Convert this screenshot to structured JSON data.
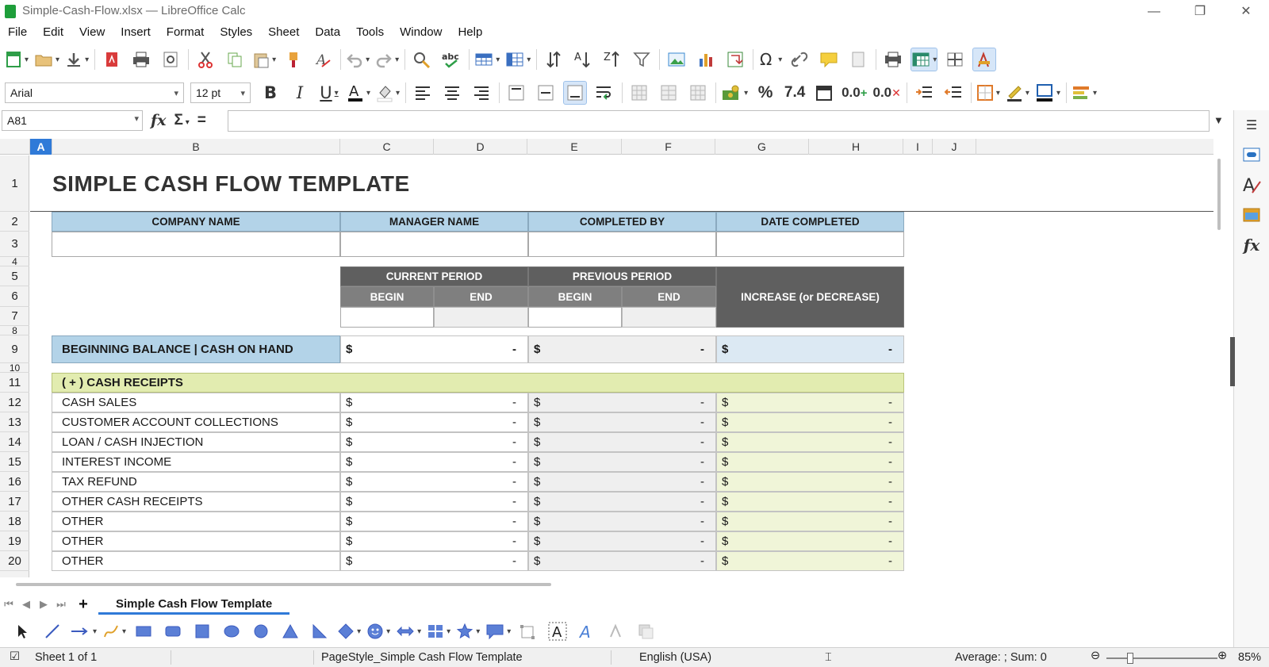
{
  "window": {
    "title": "Simple-Cash-Flow.xlsx — LibreOffice Calc",
    "controls": {
      "minimize": "—",
      "restore": "❐",
      "close": "✕"
    }
  },
  "menu": [
    "File",
    "Edit",
    "View",
    "Insert",
    "Format",
    "Styles",
    "Sheet",
    "Data",
    "Tools",
    "Window",
    "Help"
  ],
  "format_toolbar": {
    "font_name": "Arial",
    "font_size": "12 pt",
    "percent": "%",
    "number_format": "7.4",
    "add_decimal": "0.0",
    "remove_decimal": "0.0"
  },
  "formula_bar": {
    "name_box": "A81",
    "fx": "fx",
    "sum": "Σ",
    "equals": "=",
    "formula": ""
  },
  "sidebar_icons": [
    "properties-icon",
    "styles-icon",
    "gallery-icon",
    "functions-icon"
  ],
  "columns": [
    "A",
    "B",
    "C",
    "D",
    "E",
    "F",
    "G",
    "H",
    "I",
    "J"
  ],
  "selected_column": "A",
  "rows": [
    "1",
    "2",
    "3",
    "4",
    "5",
    "6",
    "7",
    "8",
    "9",
    "10",
    "11",
    "12",
    "13",
    "14",
    "15",
    "16",
    "17",
    "18",
    "19",
    "20"
  ],
  "sheet": {
    "title": "SIMPLE CASH FLOW TEMPLATE",
    "info_headers": [
      "COMPANY NAME",
      "MANAGER NAME",
      "COMPLETED BY",
      "DATE COMPLETED"
    ],
    "period_headers": {
      "current": "CURRENT PERIOD",
      "previous": "PREVIOUS PERIOD",
      "begin": "BEGIN",
      "end": "END",
      "increase": "INCREASE (or DECREASE)"
    },
    "beginning_balance": {
      "label": "BEGINNING BALANCE  |  CASH ON HAND",
      "currency": "$",
      "dash": "-"
    },
    "receipts_header": "( + )  CASH RECEIPTS",
    "receipt_rows": [
      "CASH SALES",
      "CUSTOMER ACCOUNT COLLECTIONS",
      "LOAN / CASH INJECTION",
      "INTEREST INCOME",
      "TAX REFUND",
      "OTHER CASH RECEIPTS",
      "OTHER",
      "OTHER",
      "OTHER"
    ],
    "currency_symbol": "$",
    "empty_value": "-"
  },
  "colors": {
    "header_blue": "#b3d3e8",
    "balance_blue": "#dce9f3",
    "receipts_green": "#e2ecb0",
    "receipts_green_light": "#f0f5d8",
    "dark_grey": "#5f5f5f",
    "mid_grey": "#7f7f7f",
    "selection_blue": "#2f7ad8"
  },
  "sheet_tab": "Simple Cash Flow Template",
  "status": {
    "sheet": "Sheet 1 of 1",
    "page_style": "PageStyle_Simple Cash Flow Template",
    "language": "English (USA)",
    "summary": "Average: ; Sum: 0",
    "zoom": "85%"
  }
}
